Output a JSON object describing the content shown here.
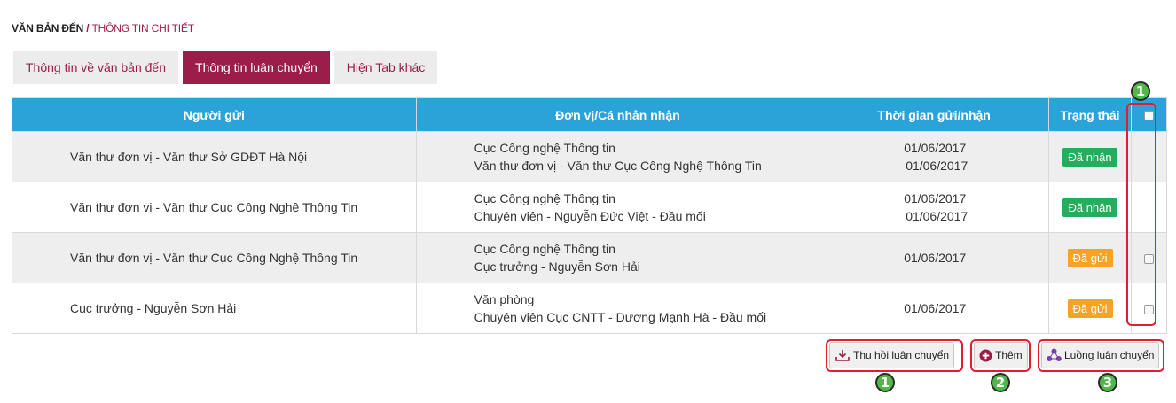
{
  "breadcrumb": {
    "root": "VĂN BẢN ĐẾN",
    "separator": " / ",
    "current": "THÔNG TIN CHI TIẾT"
  },
  "tabs": [
    {
      "label": "Thông tin về văn bản đến",
      "active": false
    },
    {
      "label": "Thông tin luân chuyển",
      "active": true
    },
    {
      "label": "Hiện Tab khác",
      "active": false
    }
  ],
  "table": {
    "headers": {
      "sender": "Người gửi",
      "receiver": "Đơn vị/Cá nhân nhận",
      "time": "Thời gian gửi/nhận",
      "status": "Trạng thái"
    },
    "rows": [
      {
        "sender": "Văn thư đơn vị - Văn thư Sở GDĐT Hà Nội",
        "receiver_line1": "Cục Công nghệ Thông tin",
        "receiver_line2": "Văn thư đơn vị - Văn thư Cục Công Nghệ Thông Tin",
        "time_line1": "01/06/2017",
        "time_line2": "01/06/2017",
        "status": "Đã nhận",
        "checkbox": false
      },
      {
        "sender": "Văn thư đơn vị - Văn thư Cục Công Nghệ Thông Tin",
        "receiver_line1": "Cục Công nghệ Thông tin",
        "receiver_line2": "Chuyên viên - Nguyễn Đức Việt - Đầu mối",
        "time_line1": "01/06/2017",
        "time_line2": "01/06/2017",
        "status": "Đã nhận",
        "checkbox": false
      },
      {
        "sender": "Văn thư đơn vị - Văn thư Cục Công Nghệ Thông Tin",
        "receiver_line1": "Cục Công nghệ Thông tin",
        "receiver_line2": "Cục trưởng - Nguyễn Sơn Hải",
        "time_line1": "01/06/2017",
        "time_line2": "",
        "status": "Đã gửi",
        "checkbox": true
      },
      {
        "sender": "Cục trưởng - Nguyễn Sơn Hải",
        "receiver_line1": "Văn phòng",
        "receiver_line2": "Chuyên viên Cục CNTT - Dương Mạnh Hà - Đầu mối",
        "time_line1": "01/06/2017",
        "time_line2": "",
        "status": "Đã gửi",
        "checkbox": true
      }
    ]
  },
  "actions": {
    "recall_label": "Thu hồi luân chuyển",
    "add_label": "Thêm",
    "flow_label": "Luồng luân chuyển"
  },
  "markers": {
    "m1": "1",
    "m2": "2",
    "m3": "3"
  },
  "icons": {
    "recall": "recall-download-icon",
    "add": "plus-circle-icon",
    "flow": "share-nodes-icon"
  },
  "colors": {
    "brand": "#9c1c4a",
    "header": "#2ca3d8",
    "received": "#24ad5c",
    "sent": "#f5a326",
    "highlight": "#e31c2f",
    "marker": "#4fb848"
  }
}
